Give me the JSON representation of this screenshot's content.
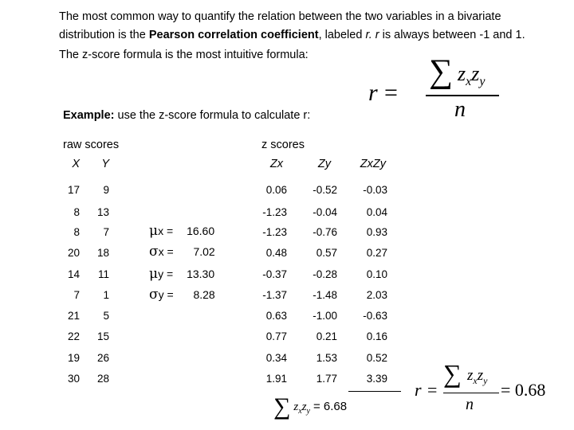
{
  "intro": {
    "p1_a": "The most common way to quantify the relation between the two variables in a bivariate distribution is the ",
    "p1_bold": "Pearson correlation coefficient",
    "p1_b": ", labeled ",
    "p1_r": "r.",
    "p1_c": "  ",
    "p1_r2": "r",
    "p1_d": " is always between -1 and 1.",
    "p2": "The z-score formula is the most intuitive formula:"
  },
  "example": {
    "bold": "Example:",
    "rest": " use the z-score formula to calculate r:"
  },
  "headers": {
    "raw": "raw scores",
    "z": "z scores",
    "x": "X",
    "y": "Y",
    "zx": "Zx",
    "zy": "Zy",
    "zxzy": "ZxZy"
  },
  "rows": [
    {
      "x": "17",
      "y": "9",
      "zx": "0.06",
      "zy": "-0.52",
      "zxzy": "-0.03"
    },
    {
      "x": "8",
      "y": "13",
      "zx": "-1.23",
      "zy": "-0.04",
      "zxzy": "0.04"
    },
    {
      "x": "8",
      "y": "7",
      "zx": "-1.23",
      "zy": "-0.76",
      "zxzy": "0.93"
    },
    {
      "x": "20",
      "y": "18",
      "zx": "0.48",
      "zy": "0.57",
      "zxzy": "0.27"
    },
    {
      "x": "14",
      "y": "11",
      "zx": "-0.37",
      "zy": "-0.28",
      "zxzy": "0.10"
    },
    {
      "x": "7",
      "y": "1",
      "zx": "-1.37",
      "zy": "-1.48",
      "zxzy": "2.03"
    },
    {
      "x": "21",
      "y": "5",
      "zx": "0.63",
      "zy": "-1.00",
      "zxzy": "-0.63"
    },
    {
      "x": "22",
      "y": "15",
      "zx": "0.77",
      "zy": "0.21",
      "zxzy": "0.16"
    },
    {
      "x": "19",
      "y": "26",
      "zx": "0.34",
      "zy": "1.53",
      "zxzy": "0.52"
    },
    {
      "x": "30",
      "y": "28",
      "zx": "1.91",
      "zy": "1.77",
      "zxzy": "3.39"
    }
  ],
  "stats": [
    {
      "sym": "μ",
      "var": "x =",
      "value": "16.60"
    },
    {
      "sym": "σ",
      "var": "x =",
      "value": "7.02"
    },
    {
      "sym": "μ",
      "var": "y =",
      "value": "13.30"
    },
    {
      "sym": "σ",
      "var": "y =",
      "value": "8.28"
    }
  ],
  "formula": {
    "r": "r",
    "eq": "=",
    "sigma": "∑",
    "z": "z",
    "sub_x": "x",
    "sub_y": "y",
    "n": "n"
  },
  "sum": {
    "value": "6.68"
  },
  "result": {
    "value": "0.68"
  }
}
